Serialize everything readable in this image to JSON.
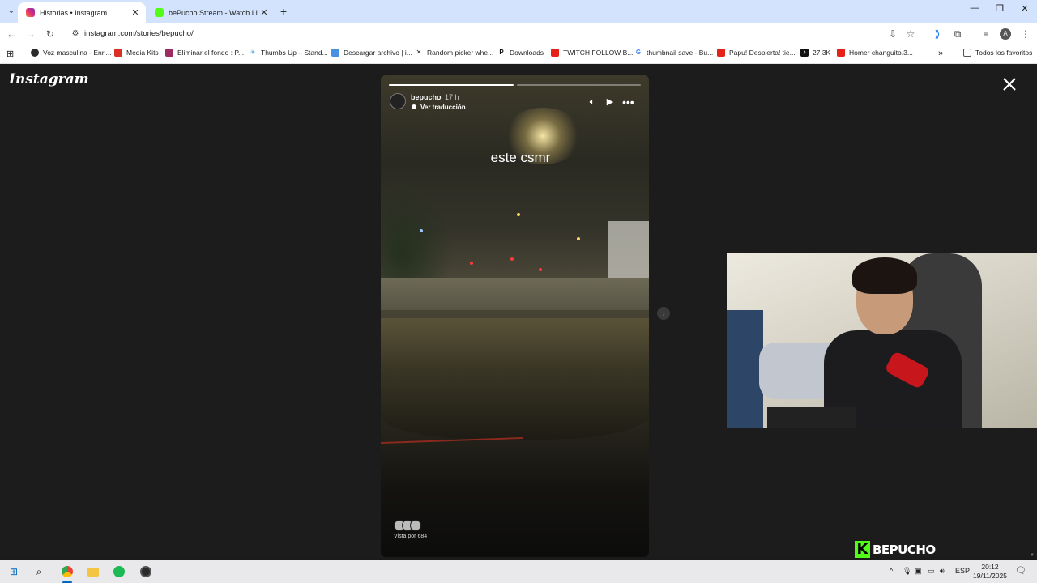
{
  "browser": {
    "tabs": [
      {
        "title": "Historias • Instagram",
        "active": true,
        "favicon": "instagram-icon",
        "color": "#dd2a7b"
      },
      {
        "title": "bePucho Stream - Watch Live on Kick",
        "active": false,
        "favicon": "kick-icon",
        "color": "#53fc18"
      }
    ],
    "url": "instagram.com/stories/bepucho/",
    "profile_initial": "A",
    "bookmarks": [
      {
        "label": "Voz masculina - Enri...",
        "icon": "voice-icon",
        "color": "#2b2b2b"
      },
      {
        "label": "Media Kits",
        "icon": "gmail-icon",
        "color": "#d93025"
      },
      {
        "label": "Eliminar el fondo : P...",
        "icon": "photopea-icon",
        "color": "#9b2c5f"
      },
      {
        "label": "Thumbs Up – Stand...",
        "icon": "star-bookmark-icon",
        "color": "#3aa0d8"
      },
      {
        "label": "Descargar archivo | i...",
        "icon": "download-site-icon",
        "color": "#4a90e2"
      },
      {
        "label": "Random picker whe...",
        "icon": "picker-icon",
        "color": "#222222"
      },
      {
        "label": "Downloads",
        "icon": "p-icon",
        "color": "#111111"
      },
      {
        "label": "TWITCH FOLLOW B...",
        "icon": "youtube-icon",
        "color": "#e62117"
      },
      {
        "label": "thumbnail save - Bu...",
        "icon": "google-icon",
        "color": "#4285f4"
      },
      {
        "label": "Papu! Despierta! tie...",
        "icon": "youtube-icon",
        "color": "#e62117"
      },
      {
        "label": "27.3K",
        "icon": "tiktok-icon",
        "color": "#111111"
      },
      {
        "label": "Homer changuito.3...",
        "icon": "youtube-icon",
        "color": "#e62117"
      }
    ],
    "all_bookmarks": "Todos los favoritos"
  },
  "instagram": {
    "logo": "Instagram",
    "story": {
      "username": "bepucho",
      "time": "17 h",
      "translation": "Ver traducción",
      "caption": "este csmr",
      "viewed_by": "Vista por 684",
      "progress": [
        1.0,
        0.0
      ]
    }
  },
  "stream": {
    "channel": "BEPUCHO",
    "brand_color": "#53fc18"
  },
  "taskbar": {
    "language": "ESP",
    "time": "20:12",
    "date": "19/11/2025"
  }
}
